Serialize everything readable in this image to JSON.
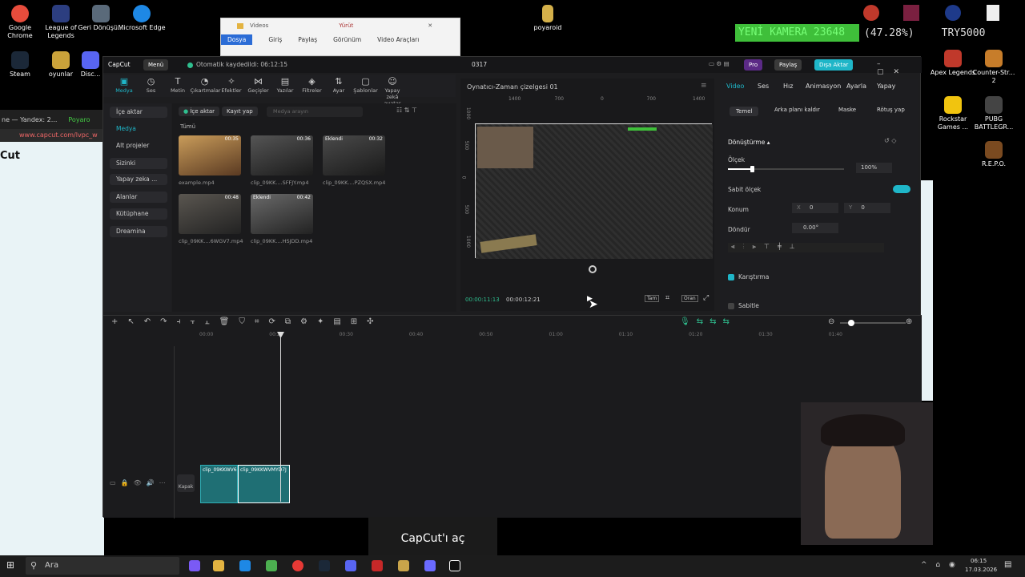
{
  "desktop": {
    "icons": [
      {
        "label": "Google Chrome",
        "color": "#e74c3c"
      },
      {
        "label": "League of Legends",
        "color": "#2c3e80"
      },
      {
        "label": "Geri Dönüşü...",
        "color": "#5a6a7a"
      },
      {
        "label": "Microsoft Edge",
        "color": "#1e88e5"
      },
      {
        "label": "Steam",
        "color": "#1b2838"
      },
      {
        "label": "oyunlar",
        "color": "#caa23a"
      },
      {
        "label": "Disc...",
        "color": "#5865f2"
      },
      {
        "label": "poyaroid",
        "color": "#d4b04a"
      },
      {
        "label": "Apex Legends",
        "color": "#c0392b"
      },
      {
        "label": "Counter-Str... 2",
        "color": "#c77d2a"
      },
      {
        "label": "Rockstar Games ...",
        "color": "#f1c40f"
      },
      {
        "label": "PUBG BATTLEGR...",
        "color": "#444"
      },
      {
        "label": "R.E.P.O.",
        "color": "#7a4a20"
      }
    ]
  },
  "browser": {
    "tab1": "ne — Yandex: 2...",
    "tab2": "Poyaro",
    "url": "www.capcut.com/lvpc_w",
    "heading": "Cut"
  },
  "explorer": {
    "title": "Videos",
    "play": "Yürüt",
    "ribbon": [
      "Dosya",
      "Giriş",
      "Paylaş",
      "Görünüm",
      "Video Araçları"
    ]
  },
  "ticker": {
    "green": "YENİ KAMERA 23648",
    "pct": "(47.28%)",
    "right": "TRY5000"
  },
  "app": {
    "logo": "CapCut",
    "menu": "Menü",
    "autosave": "Otomatik kaydedildi: 06:12:15",
    "project": "0317",
    "pro": "Pro",
    "share": "Paylaş",
    "export": "Dışa Aktar",
    "tools": [
      "Medya",
      "Ses",
      "Metin",
      "Çıkartmalar",
      "Efektler",
      "Geçişler",
      "Yazılar",
      "Filtreler",
      "Ayar",
      "Şablonlar",
      "Yapay zekâ avatar"
    ],
    "nav": [
      "İçe aktar",
      "Medya",
      "Alt projeler",
      "Sizinki",
      "Yapay zeka ...",
      "Alanlar",
      "Kütüphane",
      "Dreamina"
    ],
    "media": {
      "import": "İçe aktar",
      "record": "Kayıt yap",
      "search": "Medya arayın",
      "all": "Tümü",
      "clips": [
        {
          "name": "example.mp4",
          "dur": "00:35",
          "tag": ""
        },
        {
          "name": "clip_09KK....SFFJY.mp4",
          "dur": "00:36",
          "tag": ""
        },
        {
          "name": "clip_09KK....PZQSX.mp4",
          "dur": "00:32",
          "tag": "Eklendi"
        },
        {
          "name": "clip_09KK....6WGV7.mp4",
          "dur": "00:48",
          "tag": ""
        },
        {
          "name": "clip_09KK....HSJDD.mp4",
          "dur": "00:42",
          "tag": "Eklendi"
        }
      ]
    },
    "player": {
      "title": "Oynatıcı-Zaman çizelgesi 01",
      "cur": "00:00:11:13",
      "total": "00:00:12:21",
      "full": "Tam",
      "ratio": "Oran",
      "ruler": [
        "1400",
        "700",
        "0",
        "700",
        "1400"
      ],
      "vruler": [
        "1000",
        "500",
        "0",
        "500",
        "1000"
      ]
    },
    "props": {
      "tabs": [
        "Video",
        "Ses",
        "Hız",
        "Animasyon",
        "Ayarla",
        "Yapay"
      ],
      "sub": [
        "Temel",
        "Arka planı kaldır",
        "Maske",
        "Rötuş yap"
      ],
      "transform": "Dönüştürme",
      "scale": "Ölçek",
      "scaleVal": "100%",
      "uniform": "Sabit ölçek",
      "pos": "Konum",
      "x": "X",
      "xv": "0",
      "y": "Y",
      "yv": "0",
      "rot": "Döndür",
      "rotv": "0.00°",
      "blend": "Karıştırma",
      "stabil": "Sabitle"
    },
    "timeline": {
      "times": [
        "00:00",
        "00:20",
        "00:30",
        "00:40",
        "00:50",
        "01:00",
        "01:10",
        "01:20",
        "01:30",
        "01:40"
      ],
      "cover": "Kapak",
      "clip1": "clip_09KKWV6",
      "clip2": "clip_09KKWVMYD7J"
    }
  },
  "notice": "CapCut'ı aç",
  "taskbar": {
    "search": "Ara",
    "time": "06:15",
    "date": "17.03.2026"
  }
}
